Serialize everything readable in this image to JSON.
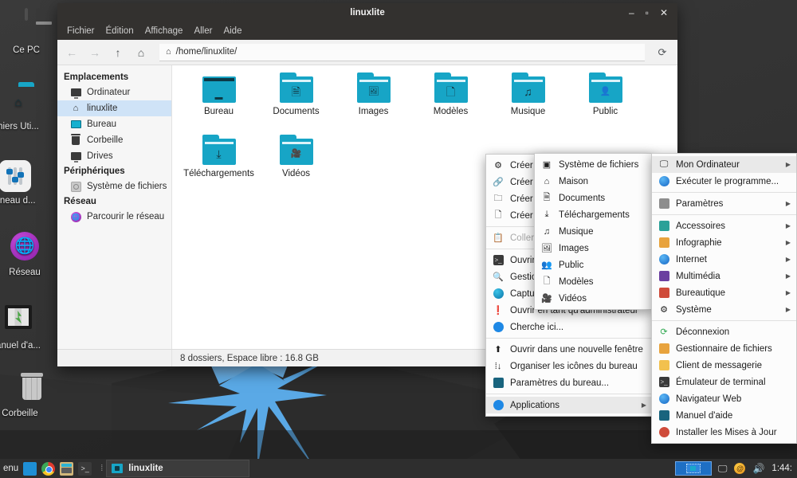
{
  "desktop": {
    "icons": [
      {
        "label": "Ce PC",
        "icon": "monitor-icon"
      },
      {
        "label": "hiers Uti...",
        "icon": "home-folder-icon"
      },
      {
        "label": "nneau d...",
        "icon": "control-panel-icon"
      },
      {
        "label": "Réseau",
        "icon": "network-globe-icon"
      },
      {
        "label": "anuel d'a...",
        "icon": "help-manual-icon"
      },
      {
        "label": "Corbeille",
        "icon": "trash-icon"
      }
    ]
  },
  "window": {
    "title": "linuxlite",
    "min_label": "–",
    "max_label": "▫",
    "close_label": "✕",
    "menubar": [
      "Fichier",
      "Édition",
      "Affichage",
      "Aller",
      "Aide"
    ],
    "toolbar": {
      "back": "←",
      "forward": "→",
      "up": "↑",
      "home": "⌂",
      "reload": "⟳"
    },
    "path": "/home/linuxlite/",
    "statusbar": "8 dossiers, Espace libre : 16.8 GB"
  },
  "sidebar": {
    "groups": [
      {
        "title": "Emplacements",
        "items": [
          {
            "label": "Ordinateur",
            "icon": "computer-icon",
            "selected": false
          },
          {
            "label": "linuxlite",
            "icon": "home-icon",
            "selected": true
          },
          {
            "label": "Bureau",
            "icon": "desktop-icon",
            "selected": false
          },
          {
            "label": "Corbeille",
            "icon": "trash-icon",
            "selected": false
          },
          {
            "label": "Drives",
            "icon": "drives-icon",
            "selected": false
          }
        ]
      },
      {
        "title": "Périphériques",
        "items": [
          {
            "label": "Système de fichiers",
            "icon": "disk-icon",
            "selected": false
          }
        ]
      },
      {
        "title": "Réseau",
        "items": [
          {
            "label": "Parcourir le réseau",
            "icon": "network-icon",
            "selected": false
          }
        ]
      }
    ]
  },
  "files": [
    {
      "label": "Bureau",
      "icon": "desktop-folder-icon",
      "emblem": "▬"
    },
    {
      "label": "Documents",
      "icon": "documents-folder-icon",
      "emblem": "🗎"
    },
    {
      "label": "Images",
      "icon": "images-folder-icon",
      "emblem": "🖼"
    },
    {
      "label": "Modèles",
      "icon": "templates-folder-icon",
      "emblem": "🗋"
    },
    {
      "label": "Musique",
      "icon": "music-folder-icon",
      "emblem": "♫"
    },
    {
      "label": "Public",
      "icon": "public-folder-icon",
      "emblem": "👤"
    },
    {
      "label": "Téléchargements",
      "icon": "downloads-folder-icon",
      "emblem": "⤓"
    },
    {
      "label": "Vidéos",
      "icon": "videos-folder-icon",
      "emblem": "🎦"
    }
  ],
  "context_menu": {
    "items": [
      {
        "label": "Créer u",
        "icon": "gear-icon",
        "sep_after": false,
        "disabled": false
      },
      {
        "label": "Créer u",
        "icon": "link-icon",
        "sep_after": false,
        "disabled": false
      },
      {
        "label": "Créer u",
        "icon": "new-folder-icon",
        "sep_after": false,
        "disabled": false
      },
      {
        "label": "Créer u",
        "icon": "new-file-icon",
        "sep_after": true,
        "disabled": false
      },
      {
        "label": "Coller",
        "icon": "paste-icon",
        "sep_after": true,
        "disabled": true
      },
      {
        "label": "Ouvrir",
        "icon": "terminal-icon",
        "sep_after": false,
        "disabled": false
      },
      {
        "label": "Gestio",
        "icon": "search-manager-icon",
        "sep_after": false,
        "disabled": false
      },
      {
        "label": "Captur",
        "icon": "screenshot-icon",
        "sep_after": false,
        "disabled": false
      },
      {
        "label": "Ouvrir en tant qu'administrateur",
        "icon": "admin-icon",
        "sep_after": false,
        "disabled": false
      },
      {
        "label": "Cherche ici...",
        "icon": "find-icon",
        "sep_after": true,
        "disabled": false
      },
      {
        "label": "Ouvrir dans une nouvelle fenêtre",
        "icon": "open-window-icon",
        "sep_after": false,
        "disabled": false
      },
      {
        "label": "Organiser les icônes du bureau",
        "icon": "arrange-icon",
        "sep_after": false,
        "disabled": false
      },
      {
        "label": "Paramètres du bureau...",
        "icon": "desktop-settings-icon",
        "sep_after": true,
        "disabled": false
      },
      {
        "label": "Applications",
        "icon": "applications-icon",
        "submenu": true,
        "highlight": true,
        "disabled": false
      }
    ]
  },
  "places_submenu": {
    "items": [
      {
        "label": "Système de fichiers",
        "icon": "filesystem-icon"
      },
      {
        "label": "Maison",
        "icon": "home-icon"
      },
      {
        "label": "Documents",
        "icon": "document-icon"
      },
      {
        "label": "Téléchargements",
        "icon": "download-icon"
      },
      {
        "label": "Musique",
        "icon": "music-icon"
      },
      {
        "label": "Images",
        "icon": "image-icon"
      },
      {
        "label": "Public",
        "icon": "people-icon"
      },
      {
        "label": "Modèles",
        "icon": "template-icon"
      },
      {
        "label": "Vidéos",
        "icon": "video-icon"
      }
    ]
  },
  "applications_menu": {
    "items": [
      {
        "label": "Mon Ordinateur",
        "icon": "monitor-icon",
        "submenu": true,
        "highlight": true,
        "sep_after": false
      },
      {
        "label": "Exécuter le programme...",
        "icon": "run-icon",
        "submenu": false,
        "sep_after": true
      },
      {
        "label": "Paramètres",
        "icon": "settings-icon",
        "submenu": true,
        "sep_after": true
      },
      {
        "label": "Accessoires",
        "icon": "accessories-icon",
        "submenu": true,
        "sep_after": false
      },
      {
        "label": "Infographie",
        "icon": "graphics-icon",
        "submenu": true,
        "sep_after": false
      },
      {
        "label": "Internet",
        "icon": "internet-icon",
        "submenu": true,
        "sep_after": false
      },
      {
        "label": "Multimédia",
        "icon": "multimedia-icon",
        "submenu": true,
        "sep_after": false
      },
      {
        "label": "Bureautique",
        "icon": "office-icon",
        "submenu": true,
        "sep_after": false
      },
      {
        "label": "Système",
        "icon": "system-icon",
        "submenu": true,
        "sep_after": true
      },
      {
        "label": "Déconnexion",
        "icon": "logout-icon",
        "submenu": false,
        "sep_after": false
      },
      {
        "label": "Gestionnaire de fichiers",
        "icon": "file-manager-icon",
        "submenu": false,
        "sep_after": false
      },
      {
        "label": "Client de messagerie",
        "icon": "mail-icon",
        "submenu": false,
        "sep_after": false
      },
      {
        "label": "Émulateur de terminal",
        "icon": "terminal-icon",
        "submenu": false,
        "sep_after": false
      },
      {
        "label": "Navigateur Web",
        "icon": "web-browser-icon",
        "submenu": false,
        "sep_after": false
      },
      {
        "label": "Manuel d'aide",
        "icon": "help-icon",
        "submenu": false,
        "sep_after": false
      },
      {
        "label": "Installer les Mises à Jour",
        "icon": "updates-icon",
        "submenu": false,
        "sep_after": false
      }
    ]
  },
  "taskbar": {
    "menu_label": "enu",
    "launchers": [
      "files-launcher-icon",
      "chrome-launcher-icon",
      "file-manager-launcher-icon",
      "terminal-launcher-icon"
    ],
    "task_label": "linuxlite",
    "tray": [
      "display-icon",
      "updates-icon",
      "volume-icon"
    ],
    "clock": "1:44:"
  },
  "colors": {
    "accent": "#17a5c6",
    "selection": "#cfe3f7",
    "titlebar": "#33312f",
    "taskbar": "#2e2e2e",
    "wallpaper": "#343434",
    "burst": "#5aa9e6"
  }
}
